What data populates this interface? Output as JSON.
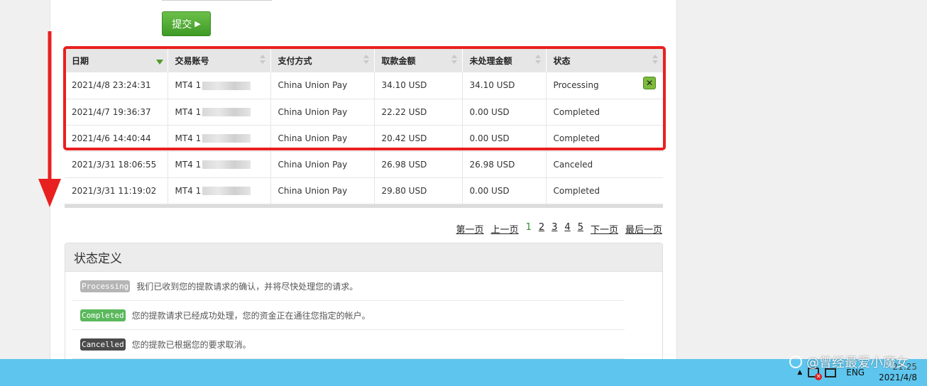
{
  "form": {
    "submit_label": "提交"
  },
  "table": {
    "headers": [
      "日期",
      "交易账号",
      "支付方式",
      "取款金额",
      "未处理金额",
      "状态"
    ],
    "rows": [
      {
        "date": "2021/4/8 23:24:31",
        "account": "MT4 1",
        "method": "China Union Pay",
        "amount": "34.10 USD",
        "pending": "34.10 USD",
        "status": "Processing"
      },
      {
        "date": "2021/4/7 19:36:37",
        "account": "MT4 1",
        "method": "China Union Pay",
        "amount": "22.22 USD",
        "pending": "0.00 USD",
        "status": "Completed"
      },
      {
        "date": "2021/4/6 14:40:44",
        "account": "MT4 1",
        "method": "China Union Pay",
        "amount": "20.42 USD",
        "pending": "0.00 USD",
        "status": "Completed"
      },
      {
        "date": "2021/3/31 18:06:55",
        "account": "MT4 1",
        "method": "China Union Pay",
        "amount": "26.98 USD",
        "pending": "26.98 USD",
        "status": "Canceled"
      },
      {
        "date": "2021/3/31 11:19:02",
        "account": "MT4 1",
        "method": "China Union Pay",
        "amount": "29.80 USD",
        "pending": "0.00 USD",
        "status": "Completed"
      }
    ]
  },
  "pager": {
    "first": "第一页",
    "prev": "上一页",
    "pages": [
      "1",
      "2",
      "3",
      "4",
      "5"
    ],
    "next": "下一页",
    "last": "最后一页"
  },
  "status_def": {
    "title": "状态定义",
    "items": [
      {
        "badge": "Processing",
        "color": "#b5b5b5",
        "desc": "我们已收到您的提款请求的确认，并将尽快处理您的请求。"
      },
      {
        "badge": "Completed",
        "color": "#5bb85c",
        "desc": "您的提款请求已经成功处理，您的资金正在通往您指定的帐户。"
      },
      {
        "badge": "Cancelled",
        "color": "#4a4a4a",
        "desc": "您的提款已根据您的要求取消。"
      }
    ]
  },
  "taskbar": {
    "lang": "ENG",
    "time": "21:25",
    "date": "2021/4/8"
  },
  "watermark": {
    "text": "@曾经最爱小魔女"
  },
  "colors": {
    "highlight": "#e82020",
    "accent_green": "#4e9a2a",
    "taskbar": "#5ec6ee"
  }
}
